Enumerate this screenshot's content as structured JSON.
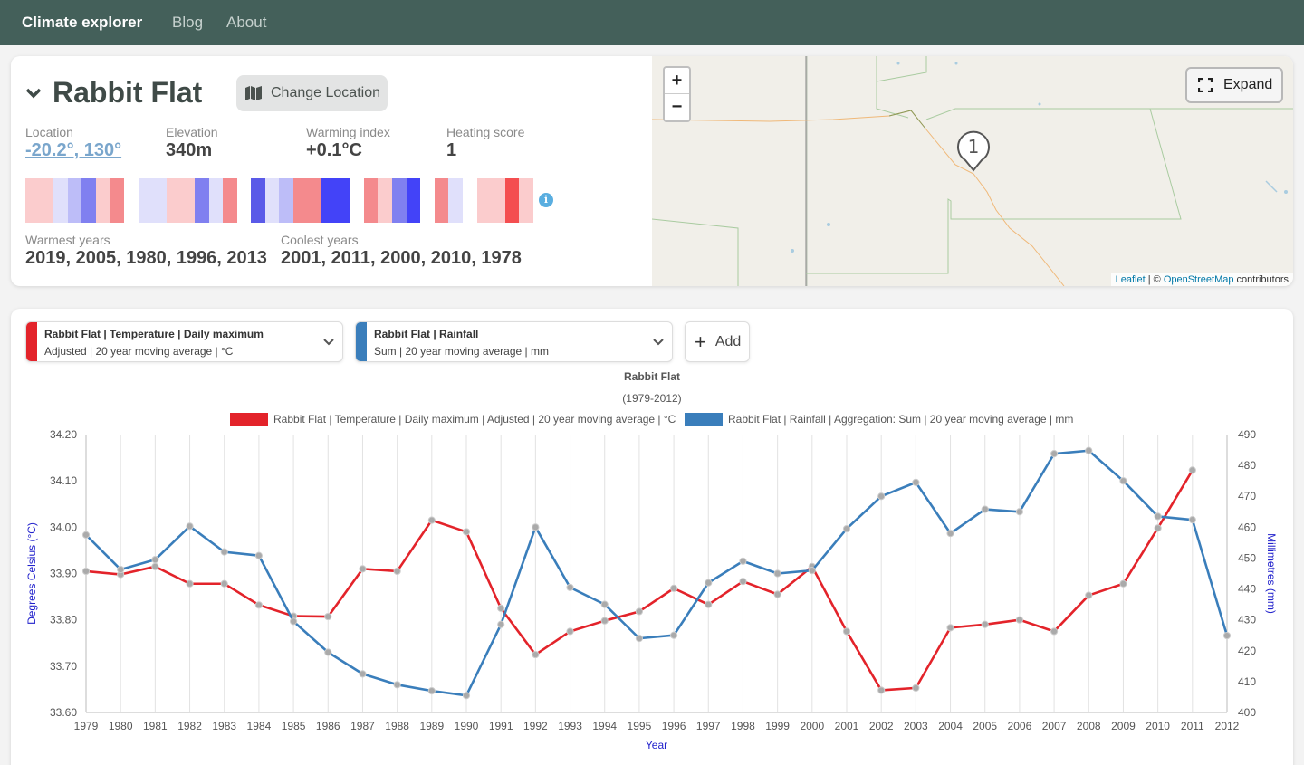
{
  "nav": {
    "brand": "Climate explorer",
    "links": [
      "Blog",
      "About"
    ]
  },
  "location": {
    "name": "Rabbit Flat",
    "change_label": "Change Location",
    "stats": [
      {
        "label": "Location",
        "value": "-20.2°, 130°"
      },
      {
        "label": "Elevation",
        "value": "340m"
      },
      {
        "label": "Warming index",
        "value": "+0.1°C"
      },
      {
        "label": "Heating score",
        "value": "1"
      }
    ],
    "warmest_label": "Warmest years",
    "warmest_value": "2019, 2005, 1980, 1996, 2013",
    "coolest_label": "Coolest years",
    "coolest_value": "2001, 2011, 2000, 2010, 1978",
    "info_icon": "i"
  },
  "warming_stripes": [
    "#fbcccd",
    "#fbcccd",
    "#e0e0fb",
    "#bdbdf8",
    "#8080f0",
    "#fbcccd",
    "#f48a8d",
    "#ffffff",
    "#e0e0fb",
    "#e0e0fb",
    "#fbcccd",
    "#fbcccd",
    "#8080f0",
    "#e0e0fb",
    "#f48a8d",
    "#ffffff",
    "#5a5ae8",
    "#e0e0fb",
    "#bdbdf8",
    "#f48a8d",
    "#f48a8d",
    "#4343f8",
    "#4343f8",
    "#ffffff",
    "#f48a8d",
    "#fbcccd",
    "#8080f0",
    "#4343f8",
    "#ffffff",
    "#f48a8d",
    "#e0e0fb",
    "#ffffff",
    "#fbcccd",
    "#fbcccd",
    "#f44e50",
    "#fbcccd"
  ],
  "map": {
    "zoom_in": "+",
    "zoom_out": "−",
    "expand_label": "Expand",
    "marker_label": "1",
    "attribution": {
      "leaflet": "Leaflet",
      "sep": " | © ",
      "osm": "OpenStreetMap",
      "suffix": " contributors"
    }
  },
  "selectors": [
    {
      "color": "#e3232a",
      "line1": "Rabbit Flat | Temperature | Daily maximum",
      "line2": "Adjusted | 20 year moving average | °C"
    },
    {
      "color": "#3a7ebb",
      "line1": "Rabbit Flat | Rainfall",
      "line2": "Sum | 20 year moving average | mm"
    }
  ],
  "add_label": "Add",
  "chart_data": {
    "type": "line",
    "title": "Rabbit Flat",
    "subtitle": "(1979-2012)",
    "xlabel": "Year",
    "ylabel": "Degrees Celsius (°C)",
    "y2label": "Millimetres (mm)",
    "x": [
      1979,
      1980,
      1981,
      1982,
      1983,
      1984,
      1985,
      1986,
      1987,
      1988,
      1989,
      1990,
      1991,
      1992,
      1993,
      1994,
      1995,
      1996,
      1997,
      1998,
      1999,
      2000,
      2001,
      2002,
      2003,
      2004,
      2005,
      2006,
      2007,
      2008,
      2009,
      2010,
      2011,
      2012
    ],
    "ylim": [
      33.6,
      34.2
    ],
    "y2lim": [
      400,
      490
    ],
    "yticks": [
      "33.60",
      "33.70",
      "33.80",
      "33.90",
      "34.00",
      "34.10",
      "34.20"
    ],
    "y2ticks": [
      400,
      410,
      420,
      430,
      440,
      450,
      460,
      470,
      480,
      490
    ],
    "grid": true,
    "legend_position": "top",
    "series": [
      {
        "name": "Rabbit Flat | Temperature | Daily maximum | Adjusted | 20 year moving average | °C",
        "axis": "left",
        "color": "#e3232a",
        "values": [
          33.905,
          33.898,
          33.915,
          33.878,
          33.878,
          33.832,
          33.808,
          33.807,
          33.91,
          33.905,
          34.015,
          33.99,
          33.825,
          33.725,
          33.775,
          33.798,
          33.818,
          33.868,
          33.833,
          33.883,
          33.855,
          33.915,
          33.775,
          33.648,
          33.653,
          33.783,
          33.79,
          33.8,
          33.775,
          33.853,
          33.878,
          33.998,
          34.123
        ]
      },
      {
        "name": "Rabbit Flat | Rainfall | Aggregation: Sum | 20 year moving average | mm",
        "axis": "right",
        "color": "#3a7ebb",
        "values": [
          457.5,
          446.3,
          449.5,
          460.3,
          452.0,
          450.8,
          429.5,
          419.5,
          412.5,
          409.0,
          407.0,
          405.5,
          428.5,
          460.0,
          440.5,
          435.0,
          424.0,
          425.0,
          442.0,
          449.0,
          445.0,
          446.0,
          459.5,
          470.0,
          474.5,
          458.0,
          465.8,
          465.0,
          483.8,
          484.8,
          475.0,
          463.5,
          462.4,
          424.9
        ]
      }
    ]
  }
}
